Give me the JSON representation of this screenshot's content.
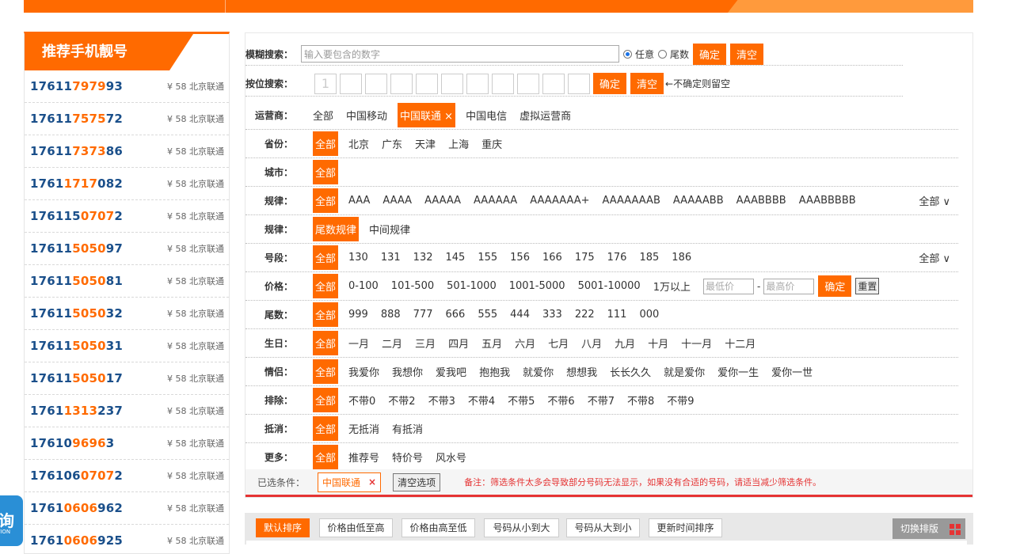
{
  "sidebar": {
    "title": "推荐手机靓号",
    "items": [
      {
        "pre": "17611",
        "hl": "7979",
        "post": "93",
        "meta": "¥ 58 北京联通"
      },
      {
        "pre": "17611",
        "hl": "7575",
        "post": "72",
        "meta": "¥ 58 北京联通"
      },
      {
        "pre": "17611",
        "hl": "7373",
        "post": "86",
        "meta": "¥ 58 北京联通"
      },
      {
        "pre": "1761",
        "hl": "1717",
        "post": "082",
        "meta": "¥ 58 北京联通"
      },
      {
        "pre": "176115",
        "hl": "0707",
        "post": "2",
        "meta": "¥ 58 北京联通"
      },
      {
        "pre": "17611",
        "hl": "5050",
        "post": "97",
        "meta": "¥ 58 北京联通"
      },
      {
        "pre": "17611",
        "hl": "5050",
        "post": "81",
        "meta": "¥ 58 北京联通"
      },
      {
        "pre": "17611",
        "hl": "5050",
        "post": "32",
        "meta": "¥ 58 北京联通"
      },
      {
        "pre": "17611",
        "hl": "5050",
        "post": "31",
        "meta": "¥ 58 北京联通"
      },
      {
        "pre": "17611",
        "hl": "5050",
        "post": "17",
        "meta": "¥ 58 北京联通"
      },
      {
        "pre": "1761",
        "hl": "1313",
        "post": "237",
        "meta": "¥ 58 北京联通"
      },
      {
        "pre": "17610",
        "hl": "9696",
        "post": "3",
        "meta": "¥ 58 北京联通"
      },
      {
        "pre": "176106",
        "hl": "0707",
        "post": "2",
        "meta": "¥ 58 北京联通"
      },
      {
        "pre": "1761",
        "hl": "0606",
        "post": "962",
        "meta": "¥ 58 北京联通"
      },
      {
        "pre": "1761",
        "hl": "0606",
        "post": "925",
        "meta": "¥ 58 北京联通"
      }
    ]
  },
  "float_btn": {
    "t1": "询",
    "t2": "TION"
  },
  "search": {
    "fuzzy_label": "模糊搜索：",
    "fuzzy_placeholder": "输入要包含的数字",
    "opt_any": "任意",
    "opt_tail": "尾数",
    "confirm": "确定",
    "clear": "清空",
    "pos_label": "按位搜索：",
    "first_digit": "1",
    "pos_tip": "←不确定则留空"
  },
  "filters": {
    "carrier": {
      "label": "运营商：",
      "items": [
        "全部",
        "中国移动",
        "中国联通 ×",
        "中国电信",
        "虚拟运营商"
      ]
    },
    "province": {
      "label": "省份：",
      "items": [
        "全部",
        "北京",
        "广东",
        "天津",
        "上海",
        "重庆"
      ]
    },
    "city": {
      "label": "城市：",
      "items": [
        "全部"
      ]
    },
    "rule1": {
      "label": "规律：",
      "items": [
        "全部",
        "AAA",
        "AAAA",
        "AAAAA",
        "AAAAAA",
        "AAAAAAA+",
        "AAAAAAAB",
        "AAAAABB",
        "AAABBBB",
        "AAABBBBB"
      ],
      "more": "全部 ∨"
    },
    "rule2": {
      "label": "规律：",
      "items": [
        "尾数规律",
        "中间规律"
      ]
    },
    "segment": {
      "label": "号段：",
      "items": [
        "全部",
        "130",
        "131",
        "132",
        "145",
        "155",
        "156",
        "166",
        "175",
        "176",
        "185",
        "186"
      ],
      "more": "全部 ∨"
    },
    "price": {
      "label": "价格：",
      "items": [
        "全部",
        "0-100",
        "101-500",
        "501-1000",
        "1001-5000",
        "5001-10000",
        "1万以上"
      ],
      "min_ph": "最低价",
      "max_ph": "最高价",
      "dash": "-",
      "confirm": "确定",
      "reset": "重置"
    },
    "tail": {
      "label": "尾数：",
      "items": [
        "全部",
        "999",
        "888",
        "777",
        "666",
        "555",
        "444",
        "333",
        "222",
        "111",
        "000"
      ]
    },
    "birthday": {
      "label": "生日：",
      "items": [
        "全部",
        "一月",
        "二月",
        "三月",
        "四月",
        "五月",
        "六月",
        "七月",
        "八月",
        "九月",
        "十月",
        "十一月",
        "十二月"
      ]
    },
    "love": {
      "label": "情侣：",
      "items": [
        "全部",
        "我爱你",
        "我想你",
        "爱我吧",
        "抱抱我",
        "就爱你",
        "想想我",
        "长长久久",
        "就是爱你",
        "爱你一生",
        "爱你一世"
      ]
    },
    "exclude": {
      "label": "排除：",
      "items": [
        "全部",
        "不带0",
        "不带2",
        "不带3",
        "不带4",
        "不带5",
        "不带6",
        "不带7",
        "不带8",
        "不带9"
      ]
    },
    "offset": {
      "label": "抵消：",
      "items": [
        "全部",
        "无抵消",
        "有抵消"
      ]
    },
    "more": {
      "label": "更多：",
      "items": [
        "全部",
        "推荐号",
        "特价号",
        "风水号"
      ]
    }
  },
  "chosen": {
    "label": "已选条件：",
    "tag": "中国联通",
    "tag_x": "×",
    "clear": "清空选项",
    "note": "备注：筛选条件太多会导致部分号码无法显示，如果没有合适的号码，请适当减少筛选条件。"
  },
  "sort": {
    "items": [
      "默认排序",
      "价格由低至高",
      "价格由高至低",
      "号码从小到大",
      "号码从大到小",
      "更新时间排序"
    ],
    "switch": "切换排版"
  },
  "colors": {
    "accent": "#ff6a00",
    "number": "#1a4f8a",
    "danger": "#e53333"
  }
}
